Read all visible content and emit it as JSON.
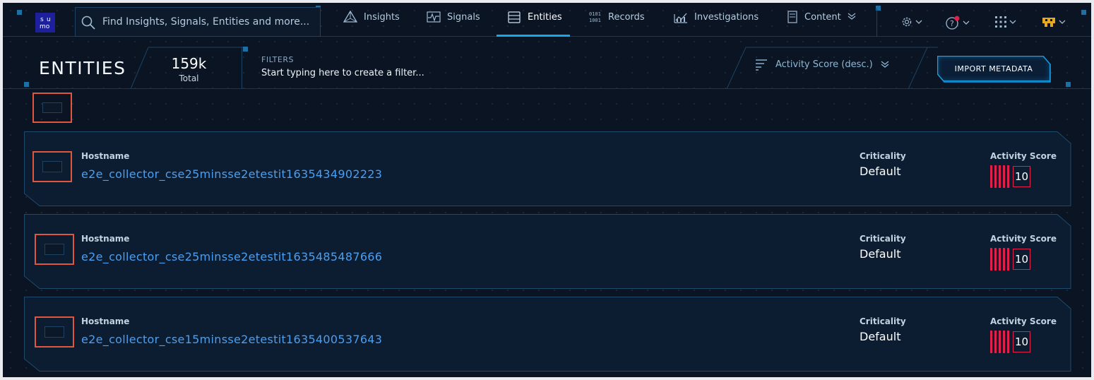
{
  "nav": {
    "logo_text": "s u mo",
    "search_placeholder": "Find Insights, Signals, Entities and more...",
    "tabs": [
      {
        "label": "Insights",
        "icon": "insights-icon"
      },
      {
        "label": "Signals",
        "icon": "signals-icon"
      },
      {
        "label": "Entities",
        "icon": "entities-icon",
        "active": true
      },
      {
        "label": "Records",
        "icon": "records-icon"
      },
      {
        "label": "Investigations",
        "icon": "investigations-icon"
      },
      {
        "label": "Content",
        "icon": "content-icon"
      }
    ],
    "settings_icon": "gear-icon",
    "help_icon": "help-icon",
    "apps_icon": "grid-icon",
    "avatar_icon": "avatar-icon"
  },
  "header": {
    "title": "ENTITIES",
    "total_count": "159k",
    "total_label": "Total",
    "filters_label": "FILTERS",
    "filters_placeholder": "Start typing here to create a filter...",
    "sort_label": "Activity Score (desc.)",
    "import_button": "IMPORT METADATA"
  },
  "entities": [
    {
      "field_label": "Hostname",
      "hostname": "e2e_collector_cse25minsse2etestit1635434902223",
      "criticality_label": "Criticality",
      "criticality": "Default",
      "score_label": "Activity Score",
      "score": "10"
    },
    {
      "field_label": "Hostname",
      "hostname": "e2e_collector_cse25minsse2etestit1635485487666",
      "criticality_label": "Criticality",
      "criticality": "Default",
      "score_label": "Activity Score",
      "score": "10"
    },
    {
      "field_label": "Hostname",
      "hostname": "e2e_collector_cse15minsse2etestit1635400537643",
      "criticality_label": "Criticality",
      "criticality": "Default",
      "score_label": "Activity Score",
      "score": "10"
    }
  ],
  "colors": {
    "background": "#0a1422",
    "accent": "#19a6e6",
    "link": "#4b9ff0",
    "score": "#e0204a",
    "checkbox_highlight": "#e0573f"
  }
}
